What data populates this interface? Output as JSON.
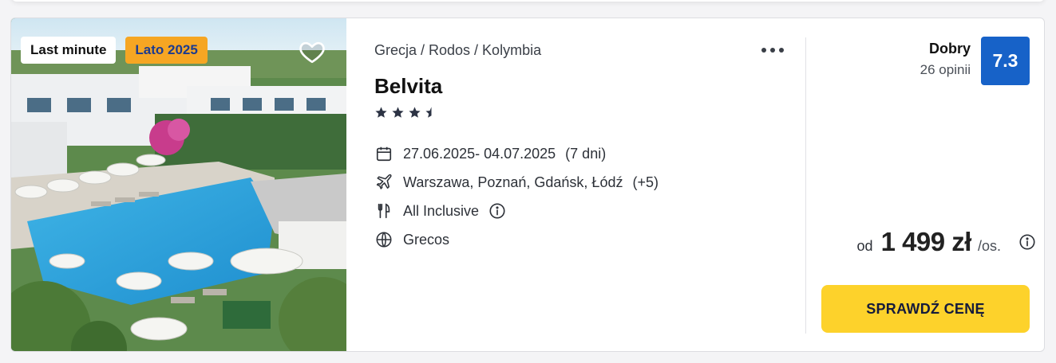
{
  "offer": {
    "badges": {
      "last_minute": "Last minute",
      "season": "Lato 2025"
    },
    "breadcrumb": "Grecja / Rodos / Kolymbia",
    "hotel_name": "Belvita",
    "stars": 3.5,
    "dates": "27.06.2025- 04.07.2025",
    "duration": "(7 dni)",
    "departures": "Warszawa, Poznań, Gdańsk, Łódź",
    "departures_more": "(+5)",
    "board": "All Inclusive",
    "operator": "Grecos",
    "rating": {
      "label": "Dobry",
      "reviews": "26 opinii",
      "score": "7.3"
    },
    "price": {
      "prefix": "od",
      "amount": "1 499 zł",
      "suffix": "/os."
    },
    "cta": "SPRAWDŹ CENĘ"
  },
  "icons": {
    "favorite": "heart-icon",
    "more": "more-dots-icon",
    "calendar": "calendar-icon",
    "plane": "plane-icon",
    "board": "cutlery-icon",
    "operator": "globe-icon",
    "info": "info-icon"
  },
  "colors": {
    "season_badge": "#f6a623",
    "score_badge": "#1762c8",
    "cta": "#fdd22b"
  }
}
